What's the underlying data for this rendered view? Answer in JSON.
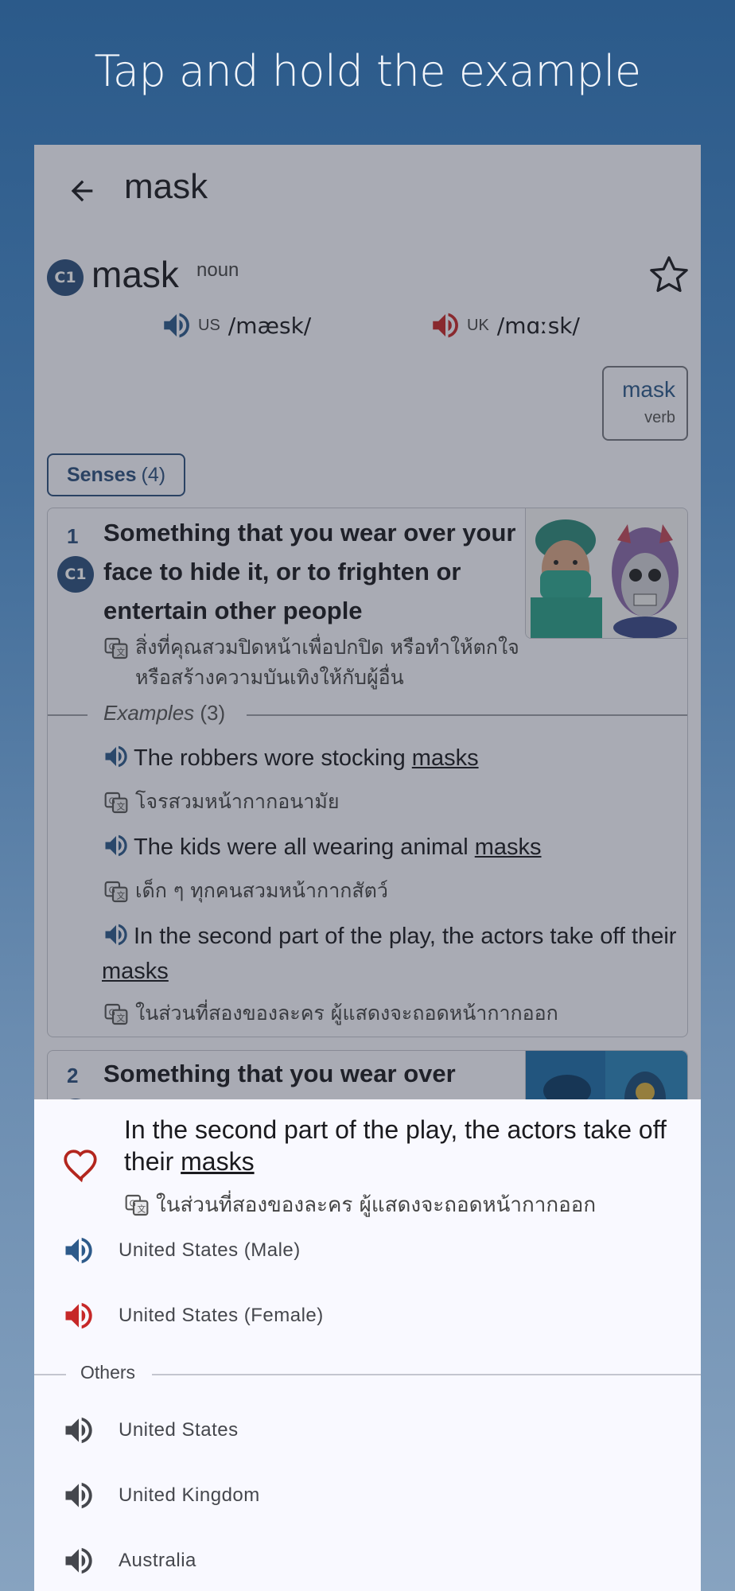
{
  "headline": "Tap and hold the example",
  "appbar": {
    "title": "mask"
  },
  "entry": {
    "level": "C1",
    "headword": "mask",
    "pos": "noun",
    "pron_us": {
      "region": "US",
      "ipa": "/mæsk/"
    },
    "pron_uk": {
      "region": "UK",
      "ipa": "/mɑːsk/"
    },
    "related": {
      "word": "mask",
      "pos": "verb"
    },
    "senses_label": "Senses",
    "senses_count": "(4)"
  },
  "sense1": {
    "num": "1",
    "level": "C1",
    "definition": "Something that you wear over your face to hide it, or to frighten or entertain other people",
    "translation": "สิ่งที่คุณสวมปิดหน้าเพื่อปกปิด หรือทำให้ตกใจหรือสร้างความบันเทิงให้กับผู้อื่น",
    "examples_label": "Examples",
    "examples_count": "(3)",
    "examples": [
      {
        "pre": "The robbers wore stocking ",
        "word": "masks",
        "post": "",
        "translation": "โจรสวมหน้ากากอนามัย"
      },
      {
        "pre": "The kids were all wearing animal ",
        "word": "masks",
        "post": "",
        "translation": "เด็ก ๆ ทุกคนสวมหน้ากากสัตว์"
      },
      {
        "pre": "In the second part of the play, the actors take off their ",
        "word": "masks",
        "post": "",
        "translation": "ในส่วนที่สองของละคร ผู้แสดงจะถอดหน้ากากออก"
      }
    ]
  },
  "sense2": {
    "num": "2",
    "definition": "Something that you wear over"
  },
  "sheet": {
    "example_pre": "In the second part of the play, the actors take off their ",
    "example_word": "masks",
    "translation": "ในส่วนที่สองของละคร ผู้แสดงจะถอดหน้ากากออก",
    "voices": [
      "United States (Male)",
      "United States (Female)"
    ],
    "others_label": "Others",
    "other_voices": [
      "United States",
      "United Kingdom",
      "Australia"
    ]
  },
  "colors": {
    "primary": "#2d4f7c",
    "uk_red": "#c62828",
    "fav_red": "#b3261e",
    "us_blue": "#2d5a8a"
  },
  "icons": [
    "back-arrow-icon",
    "star-outline-icon",
    "speaker-icon",
    "translate-icon",
    "heart-outline-icon"
  ]
}
